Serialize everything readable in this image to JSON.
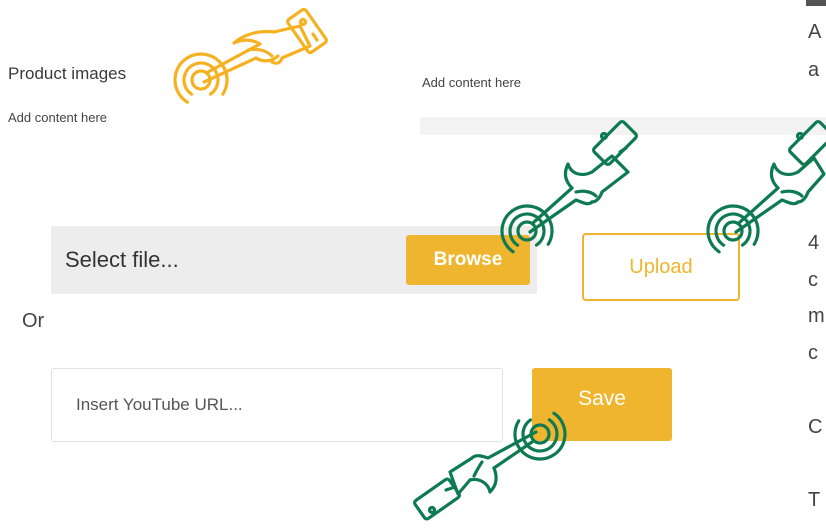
{
  "left_section": {
    "title": "Product images",
    "description": "Add content here"
  },
  "middle_section": {
    "description": "Add content here"
  },
  "right_clipped_text": [
    "A",
    "a",
    "4",
    "c",
    "m",
    "c",
    "C",
    "T"
  ],
  "file_picker": {
    "placeholder": "Select file...",
    "browse_label": "Browse",
    "upload_label": "Upload"
  },
  "or_label": "Or",
  "youtube": {
    "placeholder": "Insert YouTube URL...",
    "save_label": "Save"
  },
  "colors": {
    "accent": "#f0b52e",
    "hand_orange": "#f5b120",
    "hand_green": "#0e7a52",
    "file_box_bg": "#ededed"
  },
  "icons": {
    "hand_pointer": "pointing-hand-icon",
    "tap_rings": "tap-ring-icon"
  }
}
